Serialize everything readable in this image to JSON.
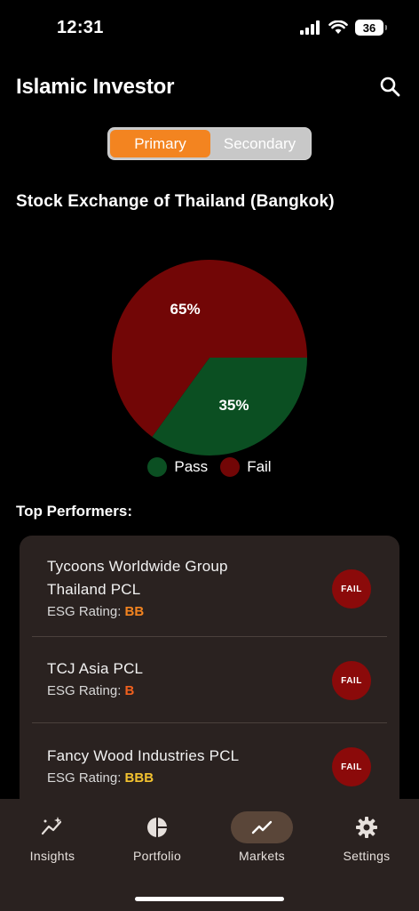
{
  "status_bar": {
    "time": "12:31",
    "battery": "36"
  },
  "header": {
    "title": "Islamic Investor"
  },
  "segments": {
    "primary": "Primary",
    "secondary": "Secondary",
    "selected": "Primary"
  },
  "market": {
    "title": "Stock Exchange of Thailand (Bangkok)"
  },
  "chart_data": {
    "type": "pie",
    "title": "",
    "categories": [
      "Pass",
      "Fail"
    ],
    "values": [
      35,
      65
    ],
    "value_labels": [
      "35%",
      "65%"
    ],
    "colors": [
      "#0b4f22",
      "#720606"
    ],
    "legend": {
      "placement": "bottom",
      "entries": [
        "Pass",
        "Fail"
      ]
    }
  },
  "top_performers": {
    "title": "Top Performers:",
    "esg_prefix": "ESG Rating:",
    "items": [
      {
        "name_line1": "Tycoons Worldwide Group",
        "name_line2": "Thailand PCL",
        "esg": "BB",
        "esg_color": "#f38420",
        "status": "FAIL"
      },
      {
        "name_line1": "TCJ Asia PCL",
        "name_line2": "",
        "esg": "B",
        "esg_color": "#f0601e",
        "status": "FAIL"
      },
      {
        "name_line1": "Fancy Wood Industries PCL",
        "name_line2": "",
        "esg": "BBB",
        "esg_color": "#f2c230",
        "status": "FAIL"
      }
    ]
  },
  "tabs": [
    {
      "label": "Insights",
      "icon": "sparkle-chart-icon"
    },
    {
      "label": "Portfolio",
      "icon": "pie-chart-icon"
    },
    {
      "label": "Markets",
      "icon": "trending-up-icon",
      "active": true
    },
    {
      "label": "Settings",
      "icon": "gear-icon"
    }
  ],
  "colors": {
    "accent": "#f38420",
    "pass": "#0b4f22",
    "fail": "#720606",
    "card": "#2a2220"
  }
}
